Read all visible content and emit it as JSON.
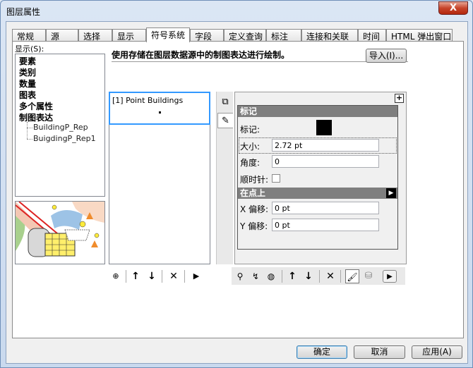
{
  "window": {
    "title": "图层属性",
    "close_label": "X"
  },
  "tabs": [
    {
      "label": "常规"
    },
    {
      "label": "源"
    },
    {
      "label": "选择"
    },
    {
      "label": "显示"
    },
    {
      "label": "符号系统",
      "active": true
    },
    {
      "label": "字段"
    },
    {
      "label": "定义查询"
    },
    {
      "label": "标注"
    },
    {
      "label": "连接和关联"
    },
    {
      "label": "时间"
    },
    {
      "label": "HTML 弹出窗口"
    }
  ],
  "show_label": "显示(S):",
  "tree": {
    "items": [
      "要素",
      "类别",
      "数量",
      "图表",
      "多个属性",
      "制图表达"
    ],
    "sub_items": [
      "BuildingP_Rep",
      "BuigdingP_Rep1"
    ]
  },
  "description": "使用存储在图层数据源中的制图表达进行绘制。",
  "import_button": "导入(I)...",
  "rep_list": {
    "item": "[1] Point Buildings"
  },
  "props": {
    "marker_header": "标记",
    "marker_label": "标记:",
    "size_label": "大小:",
    "size_value": "2.72 pt",
    "angle_label": "角度:",
    "angle_value": "0",
    "clockwise_label": "顺时针:",
    "onpoint_header": "在点上",
    "xoffset_label": "X 偏移:",
    "xoffset_value": "0 pt",
    "yoffset_label": "Y 偏移:",
    "yoffset_value": "0 pt",
    "plus_label": "+"
  },
  "buttons": {
    "ok": "确定",
    "cancel": "取消",
    "apply": "应用(A)"
  },
  "colors": {
    "accent": "#3399ff",
    "header": "#7f7f7f",
    "marker": "#000000"
  }
}
